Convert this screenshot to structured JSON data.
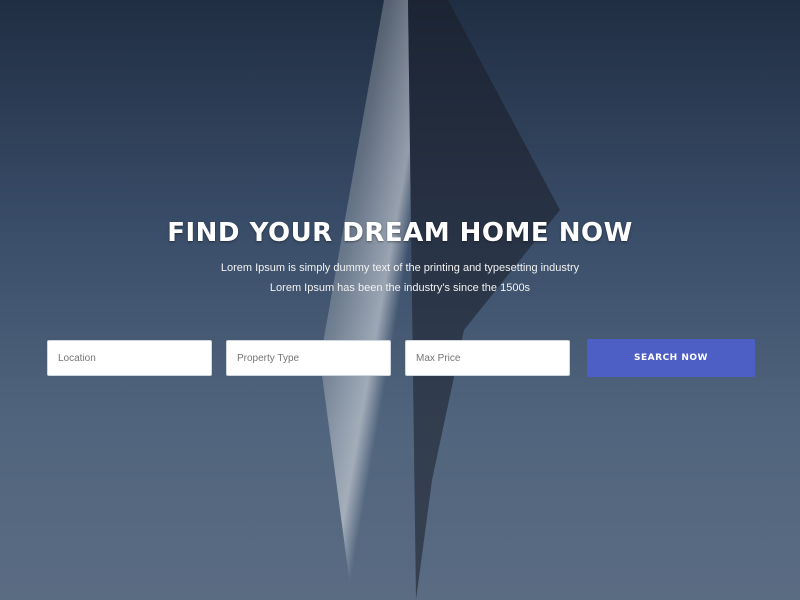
{
  "hero": {
    "headline": "FIND YOUR DREAM HOME NOW",
    "subtitle_line1": "Lorem Ipsum is simply dummy text of the printing and typesetting industry",
    "subtitle_line2": "Lorem Ipsum has been the industry's since the 1500s"
  },
  "search": {
    "field1_placeholder": "Location",
    "field2_placeholder": "Property Type",
    "field3_placeholder": "Max Price",
    "button_label": "SEARCH NOW"
  },
  "colors": {
    "button": "#4d5fc4"
  }
}
